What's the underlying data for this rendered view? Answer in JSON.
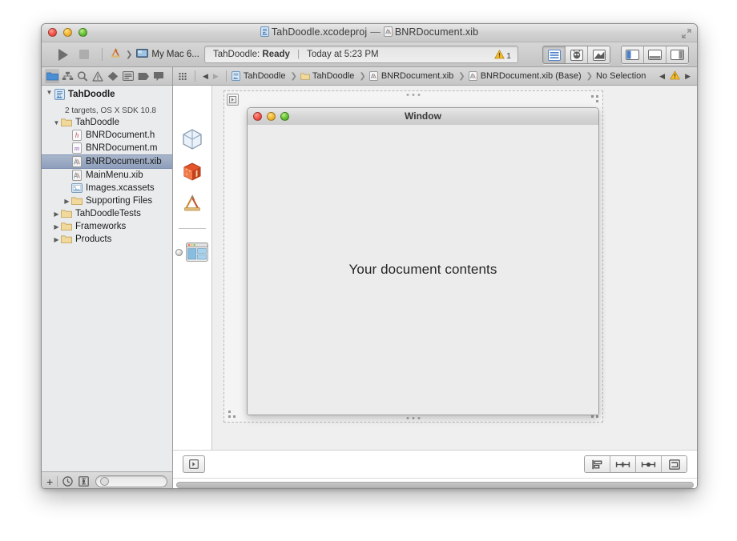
{
  "window": {
    "title_project": "TahDoodle.xcodeproj",
    "title_separator": "—",
    "title_file": "BNRDocument.xib"
  },
  "toolbar": {
    "run_label": "Run",
    "stop_label": "Stop",
    "scheme_project": "TahDoodle",
    "scheme_destination": "My Mac 6...",
    "status_project": "TahDoodle:",
    "status_state": "Ready",
    "status_divider": "|",
    "status_time": "Today at 5:23 PM",
    "warning_count": "1",
    "editor_standard": "Standard Editor",
    "editor_assistant": "Assistant Editor",
    "editor_version": "Version Editor",
    "view_navigator": "Hide Navigator",
    "view_debug": "Hide Debug Area",
    "view_utilities": "Hide Utilities"
  },
  "navigator": {
    "tabs": [
      {
        "name": "project-navigator",
        "icon": "folder-icon",
        "selected": true
      },
      {
        "name": "symbol-navigator",
        "icon": "hierarchy-icon",
        "selected": false
      },
      {
        "name": "find-navigator",
        "icon": "search-icon",
        "selected": false
      },
      {
        "name": "issue-navigator",
        "icon": "warning-triangle-icon",
        "selected": false
      },
      {
        "name": "test-navigator",
        "icon": "diamond-icon",
        "selected": false
      },
      {
        "name": "debug-navigator",
        "icon": "lines-icon",
        "selected": false
      },
      {
        "name": "breakpoint-navigator",
        "icon": "tag-icon",
        "selected": false
      },
      {
        "name": "log-navigator",
        "icon": "speech-bubble-icon",
        "selected": false
      }
    ],
    "tree": [
      {
        "label": "TahDoodle",
        "sub": "2 targets, OS X SDK 10.8",
        "icon": "xcodeproj-icon",
        "indent": 0,
        "twisty": "down",
        "bold": true,
        "selected": false
      },
      {
        "label": "TahDoodle",
        "sub": "",
        "icon": "folder-icon",
        "indent": 1,
        "twisty": "down",
        "bold": false,
        "selected": false
      },
      {
        "label": "BNRDocument.h",
        "sub": "",
        "icon": "header-file-icon",
        "indent": 2,
        "twisty": "none",
        "bold": false,
        "selected": false
      },
      {
        "label": "BNRDocument.m",
        "sub": "",
        "icon": "source-file-icon",
        "indent": 2,
        "twisty": "none",
        "bold": false,
        "selected": false
      },
      {
        "label": "BNRDocument.xib",
        "sub": "",
        "icon": "xib-file-icon",
        "indent": 2,
        "twisty": "none",
        "bold": false,
        "selected": true
      },
      {
        "label": "MainMenu.xib",
        "sub": "",
        "icon": "xib-file-icon",
        "indent": 2,
        "twisty": "none",
        "bold": false,
        "selected": false
      },
      {
        "label": "Images.xcassets",
        "sub": "",
        "icon": "xcassets-icon",
        "indent": 2,
        "twisty": "none",
        "bold": false,
        "selected": false
      },
      {
        "label": "Supporting Files",
        "sub": "",
        "icon": "folder-icon",
        "indent": 2,
        "twisty": "right",
        "bold": false,
        "selected": false
      },
      {
        "label": "TahDoodleTests",
        "sub": "",
        "icon": "folder-icon",
        "indent": 1,
        "twisty": "right",
        "bold": false,
        "selected": false
      },
      {
        "label": "Frameworks",
        "sub": "",
        "icon": "folder-icon",
        "indent": 1,
        "twisty": "right",
        "bold": false,
        "selected": false
      },
      {
        "label": "Products",
        "sub": "",
        "icon": "folder-icon",
        "indent": 1,
        "twisty": "right",
        "bold": false,
        "selected": false
      }
    ],
    "bottom": {
      "add_label": "+",
      "recent_label": "Show recent files",
      "source_control_label": "Show source control files",
      "filter_placeholder": ""
    }
  },
  "jumpbar": {
    "related_label": "Related Items",
    "back_label": "Back",
    "forward_label": "Forward",
    "crumbs": [
      {
        "label": "TahDoodle",
        "icon": "xcodeproj-icon"
      },
      {
        "label": "TahDoodle",
        "icon": "folder-icon"
      },
      {
        "label": "BNRDocument.xib",
        "icon": "xib-file-icon"
      },
      {
        "label": "BNRDocument.xib (Base)",
        "icon": "xib-file-icon"
      },
      {
        "label": "No Selection",
        "icon": ""
      }
    ],
    "prev_issue_label": "Previous Issue",
    "issue_label": "1 warning",
    "next_issue_label": "Next Issue"
  },
  "outline": {
    "placeholders": [
      {
        "name": "files-owner-placeholder",
        "icon": "wireframe-cube-icon"
      },
      {
        "name": "first-responder-placeholder",
        "icon": "orange-cube-icon"
      },
      {
        "name": "application-placeholder",
        "icon": "compass-ruler-icon"
      },
      {
        "name": "window-object",
        "icon": "window-thumbnail-icon"
      }
    ]
  },
  "canvas": {
    "nswindow_title": "Window",
    "document_contents_label": "Your document contents"
  },
  "editor_bottom": {
    "document_outline_label": "Show Document Outline",
    "align_label": "Align",
    "pin_label": "Pin",
    "resolve_label": "Resolve Auto Layout Issues",
    "resizing_label": "Resizing Behavior"
  },
  "colors": {
    "accent_blue": "#3b74d0",
    "selection_row": "#8e9fbc",
    "warning_yellow": "#f2b31d",
    "window_chrome": "#cfcfcf",
    "canvas_bg": "#efefef"
  }
}
